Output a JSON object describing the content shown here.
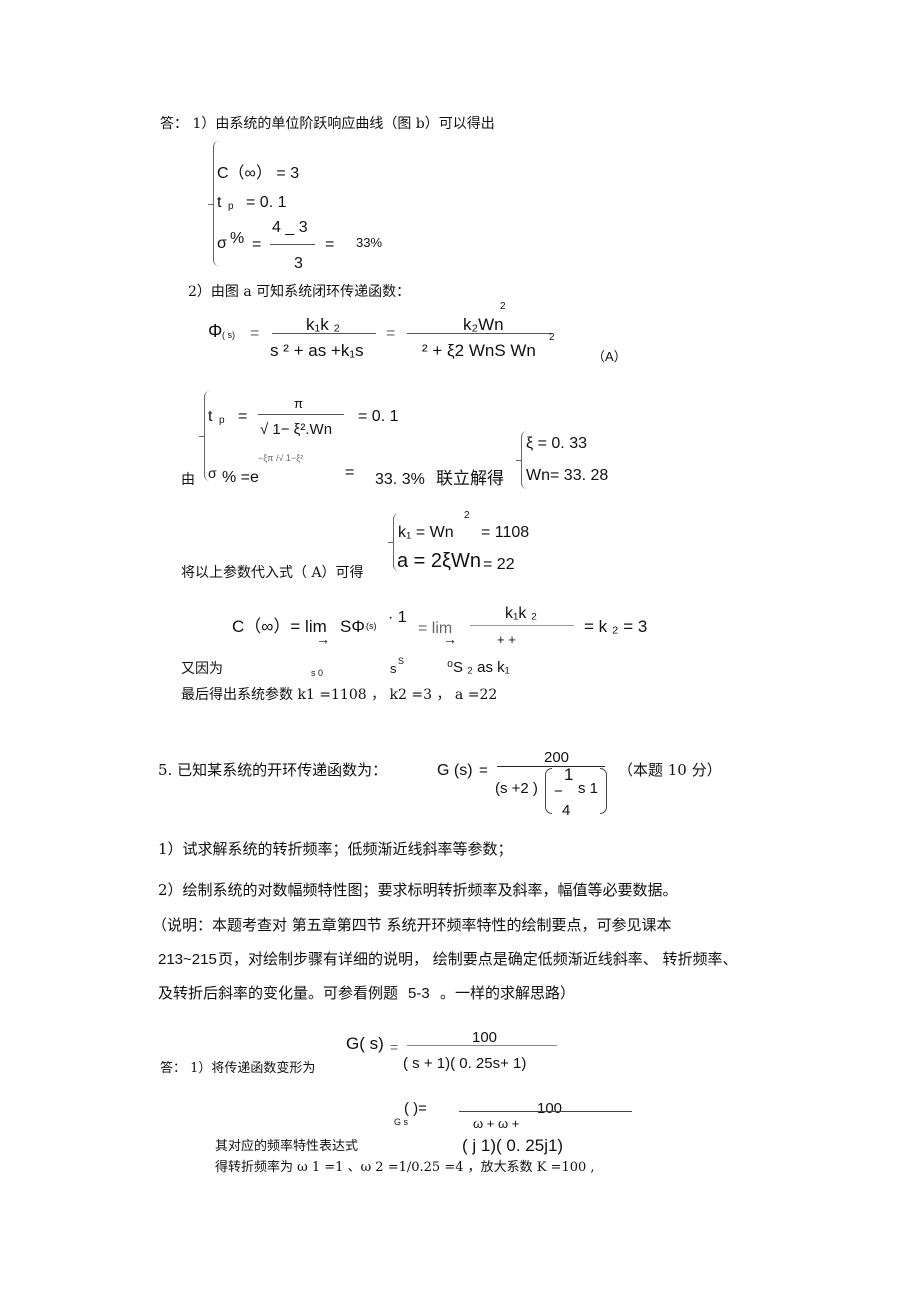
{
  "section1": {
    "intro": "答：  1）由系统的单位阶跃响应曲线（图       b）可以得出",
    "eq_c_inf": "C（∞） =  3",
    "eq_tp": "t",
    "eq_tp_sub": "p",
    "eq_tp_val": "=   0. 1",
    "eq_sigma": "σ",
    "eq_sigma_pct": "%",
    "eq_sigma_eq": "=",
    "eq_sigma_num": "4  _ 3",
    "eq_sigma_den": "3",
    "eq_sigma_eq2": "=",
    "eq_sigma_result": "33%"
  },
  "section2": {
    "intro": "2）由图  a 可知系统闭环传递函数：",
    "phi": "Φ",
    "phi_sub": "( s)",
    "eq1": "=",
    "frac1_num": "k₁k ₂",
    "frac1_den": "s   ²  +  as  +k₁s",
    "eq2": "=",
    "frac2_num": "k₂Wn",
    "frac2_num_sup": "2",
    "frac2_den": "²  +   ξ2 WnS  Wn",
    "frac2_den_sup": "2",
    "label_A": "（A）"
  },
  "section3": {
    "you": "由",
    "tp": "t",
    "tp_sub": "p",
    "tp_eq": "=",
    "tp_num": "π",
    "tp_den": "√ 1−  ξ².Wn",
    "tp_val": "=   0. 1",
    "sigma": "σ",
    "sigma_pct": "% =e",
    "sigma_exp": "−ξπ /√ 1−ξ²",
    "sigma_eq": "=",
    "sigma_val": "33. 3%",
    "solve_label": "联立解得",
    "xi": "ξ  =   0. 33",
    "wn": "Wn= 33. 28"
  },
  "section4": {
    "substitute": "将以上参数代入式（    A）可得",
    "k1_line": "k₁  = Wn",
    "k1_sup": "2",
    "k1_val": "= 1108",
    "a_line": "a = 2ξWn",
    "a_val": "= 22"
  },
  "section5": {
    "c_inf": "C（∞）= lim",
    "arrow1": "→",
    "s_phi": "SΦ",
    "phi_sub": "(s)",
    "dot_one": "· 1",
    "eq_lim": "= lim",
    "arrow2": "→",
    "frac_num": "k₁k ₂",
    "frac_den_plus": "+       +",
    "result": "= k ₂ = 3",
    "because": "又因为",
    "lim_sub1": "s     0",
    "s_s": "s",
    "s_s_sup": "S",
    "lim_sub2": "⁰S ₂    as   k₁",
    "final": "最后得出系统参数     k1 =1108   ，  k2 =3 ，  a =22"
  },
  "question5": {
    "title": "5. 已知某系统的开环传递函数为：",
    "g_s": "G (s)",
    "eq": "=",
    "num": "200",
    "den_left": "(s +2  )",
    "den_frac_num": "1",
    "den_frac_bar": "−",
    "den_frac_den": "4",
    "den_right": "s  1",
    "score": "（本题 10  分）",
    "q1": "1）试求解系统的转折频率；低频渐近线斜率等参数；",
    "q2": "2）绘制系统的对数幅频特性图；要求标明转折频率及斜率，幅值等必要数据。",
    "note1": "（说明：本题考查对     第五章第四节     系统开环频率特性的绘制要点，可参见课本",
    "note2_num": "213~215",
    "note2": "页，对绘制步骤有详细的说明，  绘制要点是确定低频渐近线斜率、  转折频率、",
    "note3": "及转折后斜率的变化量。可参看例题",
    "note3_num": "5-3",
    "note3_end": "。一样的求解思路）"
  },
  "answer5": {
    "intro": "答：  1）将传递函数变形为",
    "g_s": "G( s)",
    "eq": "=",
    "num": "100",
    "den": "( s   +     1)( 0. 25s+  1)",
    "freq_label": "其对应的频率特性表达式",
    "g_small": "G s",
    "g_paren": "(      )=",
    "freq_num": "100",
    "freq_den_top": "ω  +                     ω  +",
    "freq_den": "( j              1)( 0. 25j1)",
    "corner": "得转折频率为 ω   1 =1 、ω  2 =1/0.25 =4      ，放大系数  K =100 ,"
  }
}
